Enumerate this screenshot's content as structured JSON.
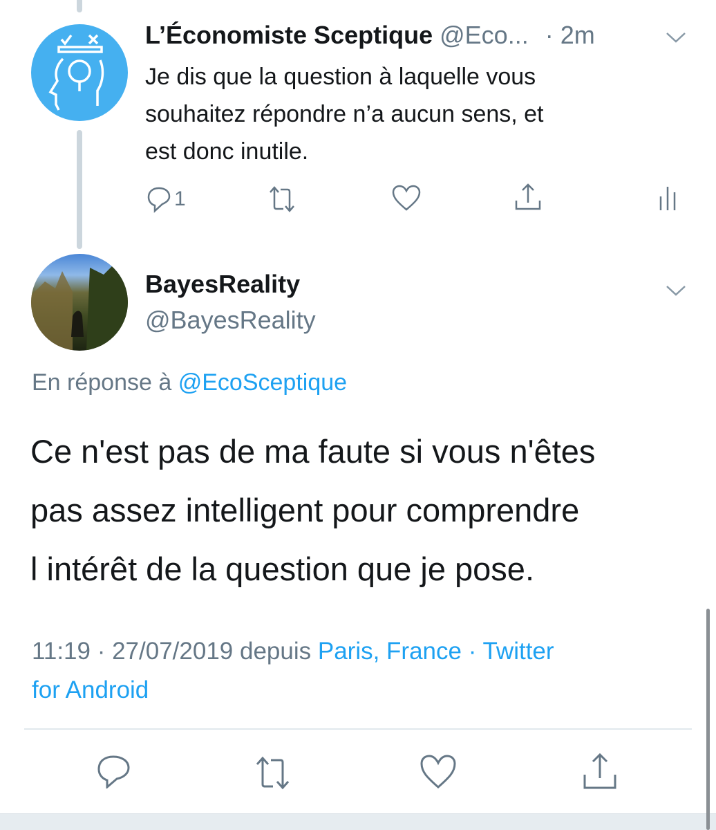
{
  "parent_tweet": {
    "author_name": "L’Économiste Sceptique",
    "handle": "@Eco...",
    "time": "· 2m",
    "text_lines": [
      "Je dis que la question à laquelle vous",
      "souhaitez répondre n’a aucun sens, et",
      "est donc inutile."
    ],
    "reply_count": "1"
  },
  "main_tweet": {
    "author_name": "BayesReality",
    "handle": "@BayesReality",
    "reply_prefix": "En réponse à",
    "reply_to": "@EcoSceptique",
    "text_lines": [
      "Ce n'est pas de ma faute si vous n'êtes",
      "pas assez intelligent pour comprendre",
      "l intérêt de la question que je pose."
    ],
    "timestamp": "11:19 · 27/07/2019 depuis",
    "location": "Paris, France",
    "sep": "·",
    "source_line1": "Twitter",
    "source_line2": "for Android"
  },
  "colors": {
    "accent": "#1da1f2",
    "gray": "#657786",
    "avatar_bg": "#45b0f0"
  }
}
